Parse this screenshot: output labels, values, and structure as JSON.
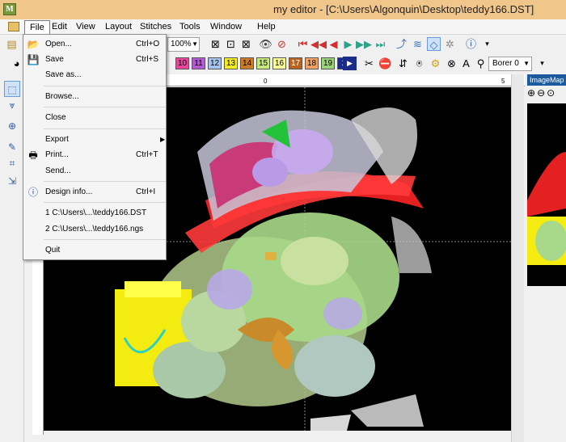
{
  "window": {
    "title": "my editor - [C:\\Users\\Algonquin\\Desktop\\teddy166.DST]",
    "app_icon": "M"
  },
  "menubar": {
    "items": [
      "File",
      "Edit",
      "View",
      "Layout",
      "Stitches",
      "Tools",
      "Window",
      "Help"
    ]
  },
  "toolbar": {
    "zoom_value": "100%",
    "color_swatches": [
      {
        "label": "10",
        "color": "#e8469a"
      },
      {
        "label": "11",
        "color": "#b35bd1"
      },
      {
        "label": "12",
        "color": "#a8c2f0"
      },
      {
        "label": "13",
        "color": "#f4ec23"
      },
      {
        "label": "14",
        "color": "#c97b2a"
      },
      {
        "label": "15",
        "color": "#c6e87a"
      },
      {
        "label": "16",
        "color": "#ffff9a"
      },
      {
        "label": "17",
        "color": "#b86322"
      },
      {
        "label": "18",
        "color": "#f0a266"
      },
      {
        "label": "19",
        "color": "#9cd37a"
      },
      {
        "label": "2",
        "color": "#1a2b8a"
      }
    ],
    "thread_combo": "Borer 0"
  },
  "ruler": {
    "ticks": [
      "0",
      "5"
    ]
  },
  "imagemap": {
    "title": "ImageMap"
  },
  "file_menu": {
    "items": [
      {
        "label": "Open...",
        "shortcut": "Ctrl+O",
        "icon": "open-folder-icon"
      },
      {
        "label": "Save",
        "shortcut": "Ctrl+S",
        "icon": "save-icon"
      },
      {
        "label": "Save as...",
        "shortcut": ""
      },
      {
        "label": "Browse...",
        "shortcut": ""
      },
      {
        "label": "Close",
        "shortcut": ""
      },
      {
        "label": "Export",
        "shortcut": ""
      },
      {
        "label": "Print...",
        "shortcut": "Ctrl+T",
        "icon": "printer-icon"
      },
      {
        "label": "Send...",
        "shortcut": ""
      },
      {
        "label": "Design info...",
        "shortcut": "Ctrl+I",
        "icon": "info-icon"
      },
      {
        "label": "1 C:\\Users\\...\\teddy166.DST",
        "shortcut": ""
      },
      {
        "label": "2 C:\\Users\\...\\teddy166.ngs",
        "shortcut": ""
      },
      {
        "label": "Quit",
        "shortcut": ""
      }
    ]
  },
  "colors": {
    "title_bar": "#f1c68b",
    "canvas_bg": "#000000",
    "panel_title": "#1c5a9e"
  }
}
